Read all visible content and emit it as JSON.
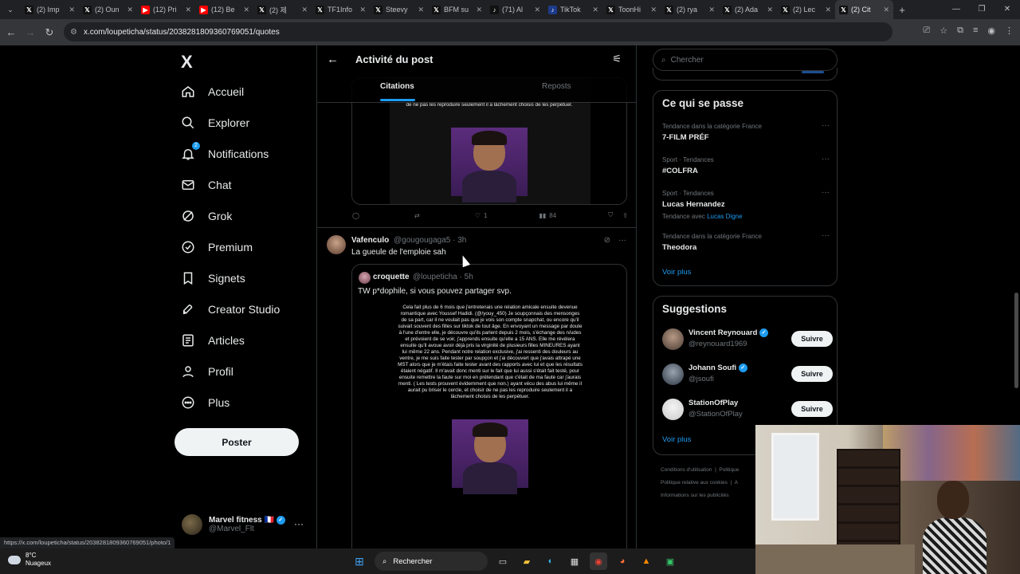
{
  "browser": {
    "tabs": [
      {
        "label": "(2) Imp",
        "icon": "x-icon",
        "color": "#000000"
      },
      {
        "label": "(2) Oun",
        "icon": "x-icon",
        "color": "#000000"
      },
      {
        "label": "(12) Pri",
        "icon": "youtube-icon",
        "color": "#ff0000"
      },
      {
        "label": "(12) Be",
        "icon": "youtube-icon",
        "color": "#ff0000"
      },
      {
        "label": "(2) 제",
        "icon": "x-icon",
        "color": "#000000"
      },
      {
        "label": "TF1Info",
        "icon": "x-icon",
        "color": "#000000"
      },
      {
        "label": "Steevy",
        "icon": "x-icon",
        "color": "#000000"
      },
      {
        "label": "BFM su",
        "icon": "x-icon",
        "color": "#000000"
      },
      {
        "label": "(71) Al",
        "icon": "tiktok-icon",
        "color": "#000000"
      },
      {
        "label": "TikTok",
        "icon": "tiktok-icon",
        "color": "#1d3b8a"
      },
      {
        "label": "ToonHi",
        "icon": "x-icon",
        "color": "#000000"
      },
      {
        "label": "(2) rya",
        "icon": "x-icon",
        "color": "#000000"
      },
      {
        "label": "(2) Ada",
        "icon": "x-icon",
        "color": "#000000"
      },
      {
        "label": "(2) Lec",
        "icon": "x-icon",
        "color": "#000000"
      },
      {
        "label": "(2) Cit",
        "icon": "x-icon",
        "color": "#000000",
        "active": true
      }
    ],
    "url": "x.com/loupeticha/status/2038281809360769051/quotes",
    "status_link": "https://x.com/loupeticha/status/2038281809360769051/photo/1"
  },
  "nav": {
    "logo": "X",
    "items": [
      {
        "label": "Accueil",
        "icon": "home-icon"
      },
      {
        "label": "Explorer",
        "icon": "search-icon"
      },
      {
        "label": "Notifications",
        "icon": "bell-icon",
        "badge": "2"
      },
      {
        "label": "Chat",
        "icon": "mail-icon"
      },
      {
        "label": "Grok",
        "icon": "grok-icon"
      },
      {
        "label": "Premium",
        "icon": "premium-icon"
      },
      {
        "label": "Signets",
        "icon": "bookmark-icon"
      },
      {
        "label": "Creator Studio",
        "icon": "rocket-icon"
      },
      {
        "label": "Articles",
        "icon": "article-icon"
      },
      {
        "label": "Profil",
        "icon": "person-icon"
      },
      {
        "label": "Plus",
        "icon": "more-circle-icon"
      }
    ],
    "post_button": "Poster",
    "account": {
      "name": "Marvel fitness 🇫🇷",
      "handle": "@Marvel_Flt"
    }
  },
  "center": {
    "title": "Activité du post",
    "tabs": [
      "Citations",
      "Reposts"
    ],
    "notes_top": "de ne pas les reproduire seulement il a lâchement choisis de les perpétuer.",
    "tweet1_actions": {
      "replies": "",
      "reposts": "",
      "likes": "1",
      "views": "84"
    },
    "tweet2": {
      "name": "Vafenculo",
      "handle": "@gougougaga5",
      "time": "3h",
      "text": "La gueule de l'emploie sah",
      "quote": {
        "name": "croquette",
        "handle": "@loupeticha",
        "time": "5h",
        "text": "TW p*dophile, si vous pouvez partager svp.",
        "notes": "Cela fait plus de 6 mois que j'entretenais une relation amicale ensuite devenue romantique avec Youssef Hadidi. (@/youy_450) Je soupçonnais des mensonges de sa part, car il ne voulait pas que je vois son compte snapchat, ou encore qu'il suivait souvent des filles sur tiktok de tout âge. En envoyant un message par doute à l'une d'entre elle, je découvre qu'ils parlent depuis 2 mois, s'échange des n/udes et prévoient de se voir, j'apprends ensuite qu'elle a 15 ANS. Elle me révèlera ensuite qu'il avoue avoir déjà pris la virginité de plusieurs filles MINEURES ayant lui même 22 ans. Pendant notre relation exclusive, j'ai ressenti des douleurs au ventre, je me suis faite tester par soupçon et j'ai découvert que j'avais attrapé une MST alors que je m'étais faite tester avant des rapports avec lui et que les résultats étaient négatif. Il m'avait donc menti sur le fait que lui aussi s'était fait testé, pour ensuite remettre la faute sur moi en prétendant que c'était de ma faute car j'aurais menti. ( Les tests prouvent évidemment que non.) ayant vécu des abus lui même il aurait pu briser le cercle, et choisir de ne pas les reproduire seulement il a lâchement choisis de les perpétuer."
      }
    }
  },
  "right": {
    "search_placeholder": "Chercher",
    "trends_title": "Ce qui se passe",
    "trends": [
      {
        "category": "Tendance dans la catégorie France",
        "title": "7-FILM PRÉF",
        "with": ""
      },
      {
        "category": "Sport · Tendances",
        "title": "#COLFRA",
        "with": ""
      },
      {
        "category": "Sport · Tendances",
        "title": "Lucas Hernandez",
        "with_prefix": "Tendance avec",
        "with": "Lucas Digne"
      },
      {
        "category": "Tendance dans la catégorie France",
        "title": "Theodora",
        "with": ""
      }
    ],
    "see_more": "Voir plus",
    "suggestions_title": "Suggestions",
    "suggestions": [
      {
        "name": "Vincent Reynouard",
        "handle": "@reynouard1969",
        "verified": true,
        "button": "Suivre"
      },
      {
        "name": "Johann Soufi",
        "handle": "@jsoufi",
        "verified": true,
        "button": "Suivre"
      },
      {
        "name": "StationOfPlay",
        "handle": "@StationOfPlay",
        "verified": false,
        "button": "Suivre"
      }
    ],
    "footer": [
      "Conditions d'utilisation",
      "Politique",
      "Politique relative aux cookies",
      "A",
      "Informations sur les publicités"
    ]
  },
  "taskbar": {
    "temp": "8°C",
    "weather": "Nuageux",
    "search": "Rechercher"
  }
}
